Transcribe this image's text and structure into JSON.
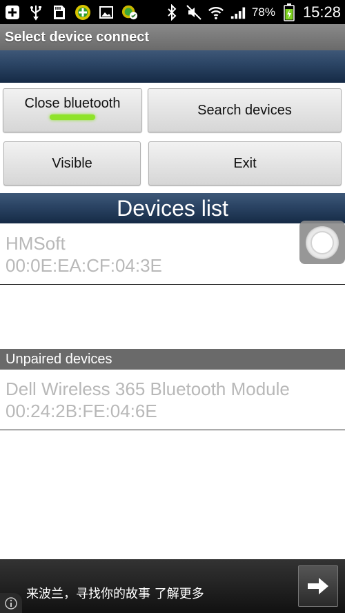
{
  "status_bar": {
    "icons_left": [
      "add-icon",
      "usb-icon",
      "sd-card-icon",
      "app-icon",
      "image-icon",
      "sync-icon"
    ],
    "icons_right": [
      "bluetooth-icon",
      "mute-icon",
      "wifi-icon",
      "signal-icon"
    ],
    "battery": "78%",
    "time": "15:28"
  },
  "titlebar": {
    "title": "Select device connect"
  },
  "buttons": {
    "close_bluetooth": "Close bluetooth",
    "search_devices": "Search devices",
    "visible": "Visible",
    "exit": "Exit"
  },
  "list": {
    "header": "Devices list",
    "paired": [
      {
        "name": "HMSoft",
        "address": "00:0E:EA:CF:04:3E"
      }
    ],
    "unpaired_label": "Unpaired devices",
    "unpaired": [
      {
        "name": "Dell Wireless 365 Bluetooth Module",
        "address": "00:24:2B:FE:04:6E"
      }
    ]
  },
  "ad": {
    "text": "来波兰，寻找你的故事 了解更多"
  },
  "colors": {
    "accent_blue": "#2a4363",
    "indicator_green": "#8fe32a"
  }
}
